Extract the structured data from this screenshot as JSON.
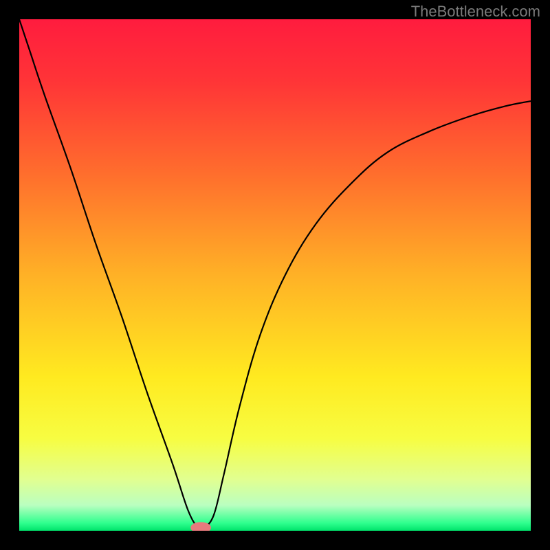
{
  "watermark": "TheBottleneck.com",
  "chart_data": {
    "type": "line",
    "title": "",
    "xlabel": "",
    "ylabel": "",
    "xlim": [
      0,
      100
    ],
    "ylim": [
      0,
      100
    ],
    "grid": false,
    "background_gradient": {
      "stops": [
        {
          "pos": 0.0,
          "color": "#ff1c3e"
        },
        {
          "pos": 0.12,
          "color": "#ff3437"
        },
        {
          "pos": 0.3,
          "color": "#ff6d2d"
        },
        {
          "pos": 0.5,
          "color": "#ffb126"
        },
        {
          "pos": 0.7,
          "color": "#ffea20"
        },
        {
          "pos": 0.82,
          "color": "#f7fd42"
        },
        {
          "pos": 0.9,
          "color": "#e1ff91"
        },
        {
          "pos": 0.95,
          "color": "#baffc0"
        },
        {
          "pos": 0.985,
          "color": "#2fff8e"
        },
        {
          "pos": 1.0,
          "color": "#00e36b"
        }
      ]
    },
    "series": [
      {
        "name": "bottleneck-curve",
        "stroke": "#000000",
        "stroke_width": 2.2,
        "x": [
          0,
          2,
          5,
          10,
          15,
          20,
          25,
          30,
          33,
          35,
          36,
          38,
          40,
          43,
          47,
          52,
          58,
          65,
          72,
          80,
          88,
          95,
          100
        ],
        "y": [
          100,
          94,
          85,
          71,
          56,
          42,
          27,
          13,
          4,
          0.5,
          0.5,
          3,
          11,
          24,
          38,
          50,
          60,
          68,
          74,
          78,
          81,
          83,
          84
        ]
      }
    ],
    "marker": {
      "name": "optimum-marker",
      "x": 35.5,
      "y": 0.6,
      "rx": 2.0,
      "ry": 1.1,
      "color": "#e77a7d"
    }
  }
}
